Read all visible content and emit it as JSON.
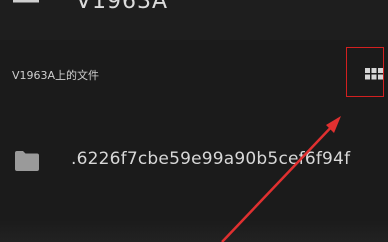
{
  "app_bar": {
    "title": "V1963A",
    "menu_icon": "hamburger-menu-icon"
  },
  "section": {
    "title": "V1963A上的文件",
    "view_toggle_icon": "grid-view-icon"
  },
  "files": [
    {
      "name": ".6226f7cbe59e99a90b5cef6f94f",
      "icon": "folder-icon"
    }
  ],
  "colors": {
    "background": "#1b1b1b",
    "highlight_box": "#d32020",
    "arrow": "#e03030"
  }
}
